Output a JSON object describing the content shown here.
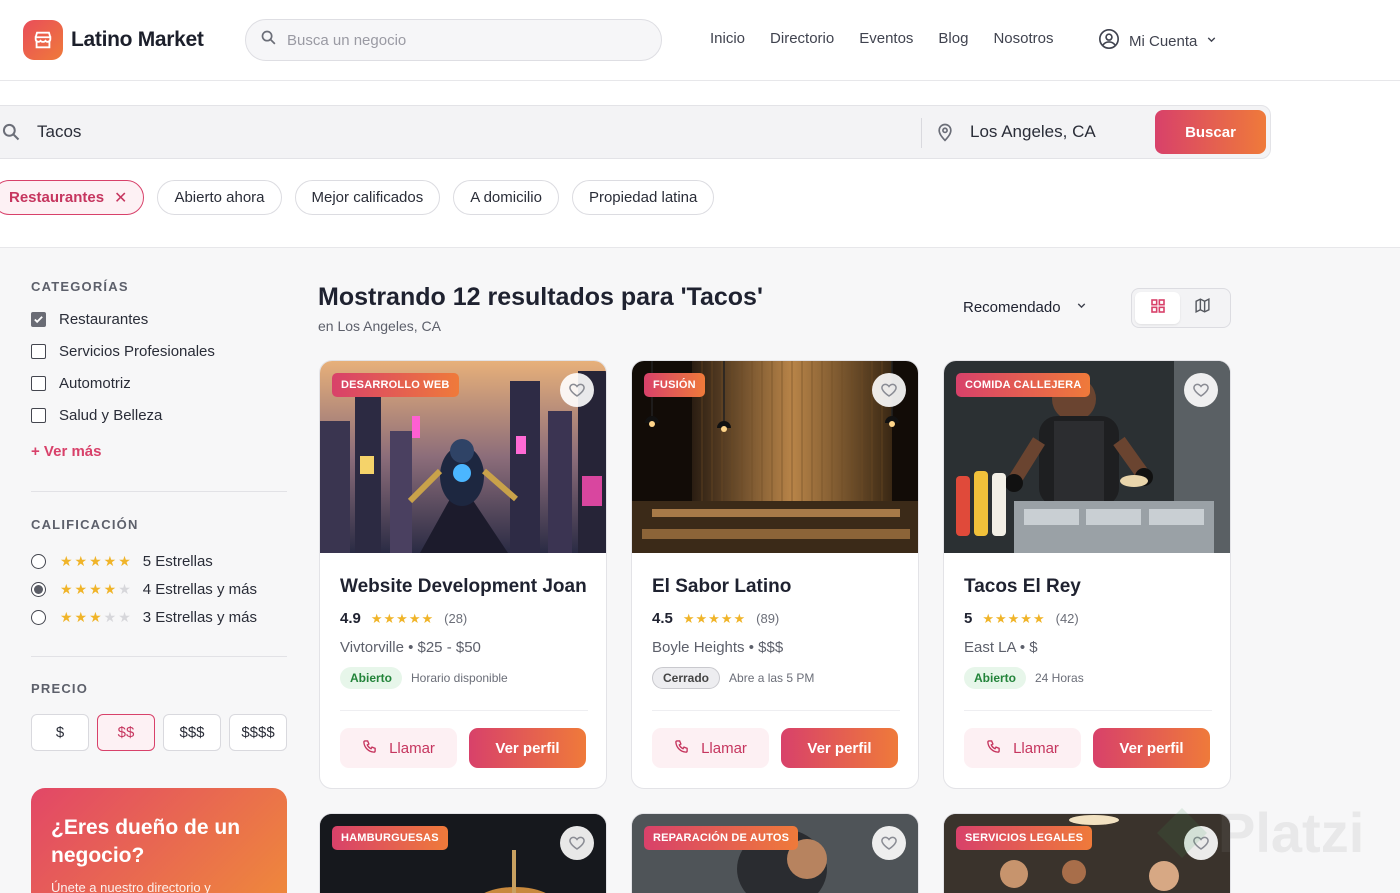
{
  "brand": {
    "name": "Latino Market"
  },
  "top_search": {
    "placeholder": "Busca un negocio"
  },
  "nav": [
    "Inicio",
    "Directorio",
    "Eventos",
    "Blog",
    "Nosotros"
  ],
  "account": {
    "label": "Mi Cuenta"
  },
  "search": {
    "query": "Tacos",
    "location": "Los Angeles, CA",
    "button": "Buscar"
  },
  "chips": [
    {
      "label": "Restaurantes",
      "active": true
    },
    {
      "label": "Abierto ahora"
    },
    {
      "label": "Mejor calificados"
    },
    {
      "label": "A domicilio"
    },
    {
      "label": "Propiedad latina"
    }
  ],
  "sidebar": {
    "categories_title": "CATEGORÍAS",
    "categories": [
      {
        "label": "Restaurantes",
        "checked": true
      },
      {
        "label": "Servicios Profesionales",
        "checked": false
      },
      {
        "label": "Automotriz",
        "checked": false
      },
      {
        "label": "Salud y Belleza",
        "checked": false
      }
    ],
    "more": "+ Ver más",
    "rating_title": "CALIFICACIÓN",
    "ratings": [
      {
        "label": "5 Estrellas",
        "stars": 5,
        "selected": false
      },
      {
        "label": "4 Estrellas y más",
        "stars": 4,
        "selected": true
      },
      {
        "label": "3 Estrellas y más",
        "stars": 3,
        "selected": false
      }
    ],
    "price_title": "PRECIO",
    "prices": [
      {
        "label": "$",
        "selected": false
      },
      {
        "label": "$$",
        "selected": true
      },
      {
        "label": "$$$",
        "selected": false
      },
      {
        "label": "$$$$",
        "selected": false
      }
    ],
    "owner_title": "¿Eres dueño de un negocio?",
    "owner_text": "Únete a nuestro directorio y"
  },
  "results": {
    "title": "Mostrando 12 resultados para 'Tacos'",
    "subtitle": "en Los Angeles, CA",
    "sort": "Recomendado",
    "view_icons": [
      "grid-icon",
      "map-icon"
    ]
  },
  "cards": [
    {
      "tag": "DESARROLLO WEB",
      "name": "Website Development Joan",
      "rating": "4.9",
      "reviews": "(28)",
      "meta": "Vivtorville • $25 - $50",
      "status": "Abierto",
      "status_type": "open",
      "hours": "Horario disponible",
      "call": "Llamar",
      "profile": "Ver perfil",
      "image": "futuristic-city-robot"
    },
    {
      "tag": "FUSIÓN",
      "name": "El Sabor Latino",
      "rating": "4.5",
      "reviews": "(89)",
      "meta": "Boyle Heights • $$$",
      "status": "Cerrado",
      "status_type": "closed",
      "hours": "Abre a las 5 PM",
      "call": "Llamar",
      "profile": "Ver perfil",
      "image": "restaurant-interior"
    },
    {
      "tag": "COMIDA CALLEJERA",
      "name": "Tacos El Rey",
      "rating": "5",
      "reviews": "(42)",
      "meta": "East LA • $",
      "status": "Abierto",
      "status_type": "open",
      "hours": "24 Horas",
      "call": "Llamar",
      "profile": "Ver perfil",
      "image": "chef-preparing-tacos"
    }
  ],
  "cards_row2": [
    {
      "tag": "HAMBURGUESAS",
      "image": "burger"
    },
    {
      "tag": "REPARACIÓN DE AUTOS",
      "image": "mechanic"
    },
    {
      "tag": "SERVICIOS LEGALES",
      "image": "office-people"
    }
  ],
  "watermark": {
    "text": "Platzi"
  },
  "colors": {
    "accent_start": "#d8416a",
    "accent_end": "#ef7a3a",
    "open_green": "#23843a",
    "star": "#f0b429"
  }
}
